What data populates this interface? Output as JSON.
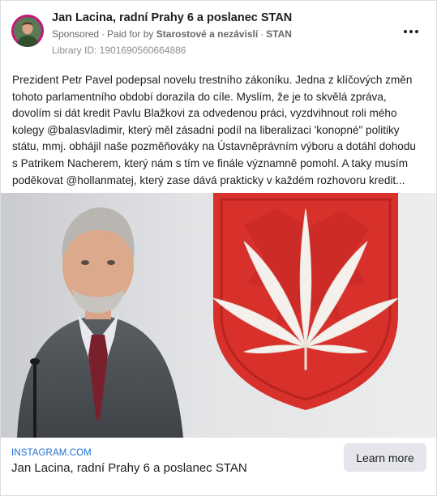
{
  "post": {
    "author": "Jan Lacina, radní Prahy 6 a poslanec STAN",
    "sponsored_label": "Sponsored",
    "paid_for_prefix": "Paid for by",
    "paid_for_by": "Starostové a nezávislí",
    "party": "STAN",
    "library_id": "Library ID: 1901690560664886",
    "more_icon": "more-horizontal-icon"
  },
  "body": {
    "lines": [
      "Prezident Petr Pavel podepsal novelu trestního zákoníku. Jedna z klíčových změn",
      "tohoto parlamentního období dorazila do cíle.  Myslím, že je to skvělá zpráva,",
      "dovolím si dát kredit Pavlu Blažkovi za odvedenou práci, vyzdvihnout roli mého",
      "kolegy @balasvladimir, který měl zásadní podíl na liberalizaci 'konopné\" politiky",
      "státu, mmj. obhájil naše pozměňováky na Ústavněprávním výboru a dotáhl dohodu",
      "s Patrikem Nacherem, který nám s tím ve finále významně pomohl. A taky musím",
      "poděkovat @hollanmatej, který zase dává prakticky v každém rozhovoru kredit..."
    ]
  },
  "link": {
    "domain": "INSTAGRAM.COM",
    "title": "Jan Lacina, radní Prahy 6 a poslanec STAN",
    "cta": "Learn more"
  },
  "colors": {
    "accent_link": "#1f6fd1",
    "avatar_ring": "#c2187a",
    "emblem_red": "#d8302b",
    "button_bg": "#e4e6eb"
  }
}
